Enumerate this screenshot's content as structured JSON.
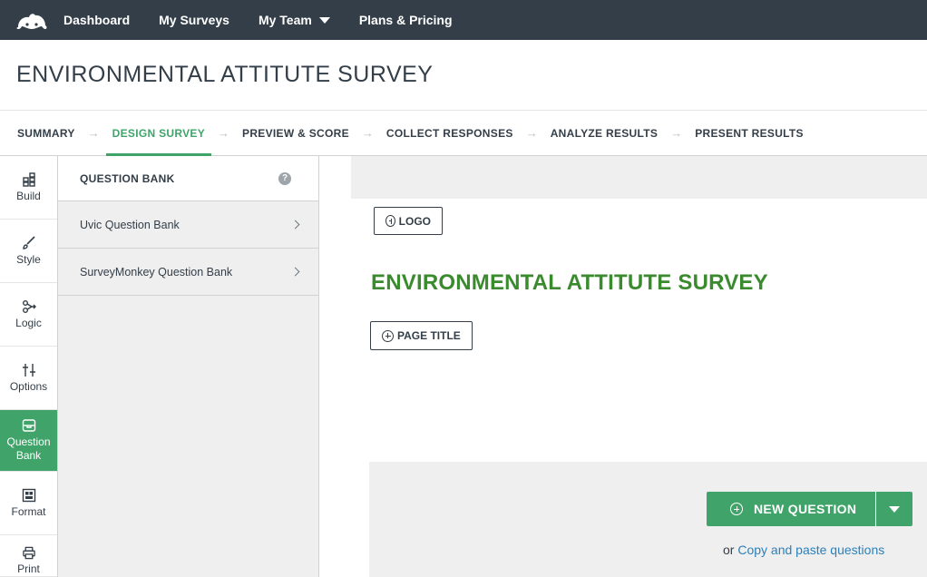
{
  "nav": {
    "items": [
      "Dashboard",
      "My Surveys",
      "My Team",
      "Plans & Pricing"
    ]
  },
  "survey": {
    "title": "ENVIRONMENTAL ATTITUTE SURVEY"
  },
  "steps": [
    "SUMMARY",
    "DESIGN SURVEY",
    "PREVIEW & SCORE",
    "COLLECT RESPONSES",
    "ANALYZE RESULTS",
    "PRESENT RESULTS"
  ],
  "active_step": "DESIGN SURVEY",
  "rail": {
    "items": [
      "Build",
      "Style",
      "Logic",
      "Options",
      "Question Bank",
      "Format",
      "Print"
    ]
  },
  "panel": {
    "title": "QUESTION BANK",
    "help": "?",
    "items": [
      "Uvic Question Bank",
      "SurveyMonkey Question Bank"
    ]
  },
  "canvas": {
    "logo_label": "LOGO",
    "page_title_label": "PAGE TITLE",
    "survey_title": "ENVIRONMENTAL ATTITUTE SURVEY",
    "new_question_label": "NEW QUESTION",
    "paste_prefix": "or",
    "paste_link": "Copy and paste questions"
  },
  "colors": {
    "nav_bg": "#333e48",
    "accent": "#40a46a",
    "title_green": "#3a8a2e",
    "link": "#2b80b9"
  }
}
